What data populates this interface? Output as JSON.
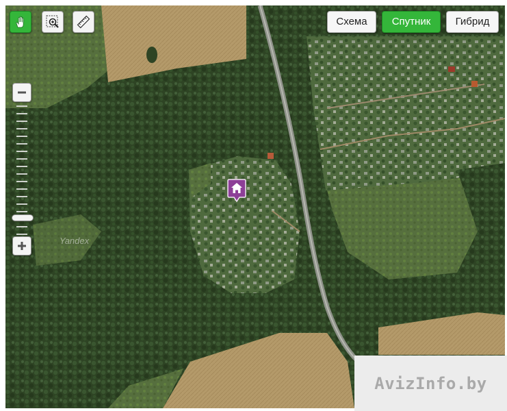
{
  "map": {
    "tools": [
      {
        "id": "drag",
        "icon": "hand-icon",
        "active": true
      },
      {
        "id": "magnifier",
        "icon": "zoom-area-icon",
        "active": false
      },
      {
        "id": "ruler",
        "icon": "ruler-icon",
        "active": false
      }
    ],
    "type_buttons": [
      {
        "label": "Схема",
        "active": false
      },
      {
        "label": "Спутник",
        "active": true
      },
      {
        "label": "Гибрид",
        "active": false
      }
    ],
    "zoom": {
      "minus_icon": "minus-icon",
      "plus_icon": "plus-icon"
    },
    "marker": {
      "icon": "house-icon",
      "color": "#8d3f97"
    },
    "provider_label": "Yandex",
    "accent_color": "#34b63a"
  },
  "watermark": {
    "text": "AvizInfo.by"
  }
}
